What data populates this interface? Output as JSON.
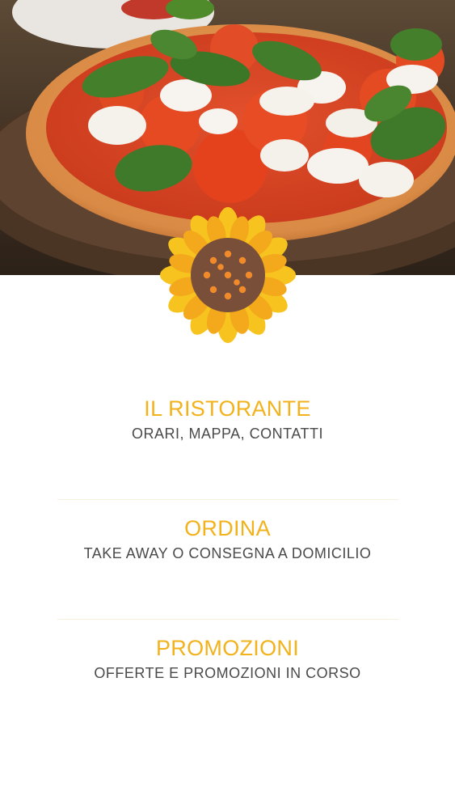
{
  "hero": {
    "image": "pizza-margherita-photo"
  },
  "logo": {
    "icon": "sunflower-icon",
    "petal_color": "#f7c41f",
    "center_color": "#7a4f3a",
    "seed_color": "#f08a2a"
  },
  "menu": {
    "items": [
      {
        "title": "IL RISTORANTE",
        "subtitle": "ORARI, MAPPA, CONTATTI"
      },
      {
        "title": "ORDINA",
        "subtitle": "TAKE AWAY O CONSEGNA A DOMICILIO"
      },
      {
        "title": "PROMOZIONI",
        "subtitle": "OFFERTE E PROMOZIONI IN CORSO"
      }
    ]
  },
  "colors": {
    "accent": "#f2b21b",
    "text": "#4a4a4a",
    "divider": "#f6efdc"
  }
}
